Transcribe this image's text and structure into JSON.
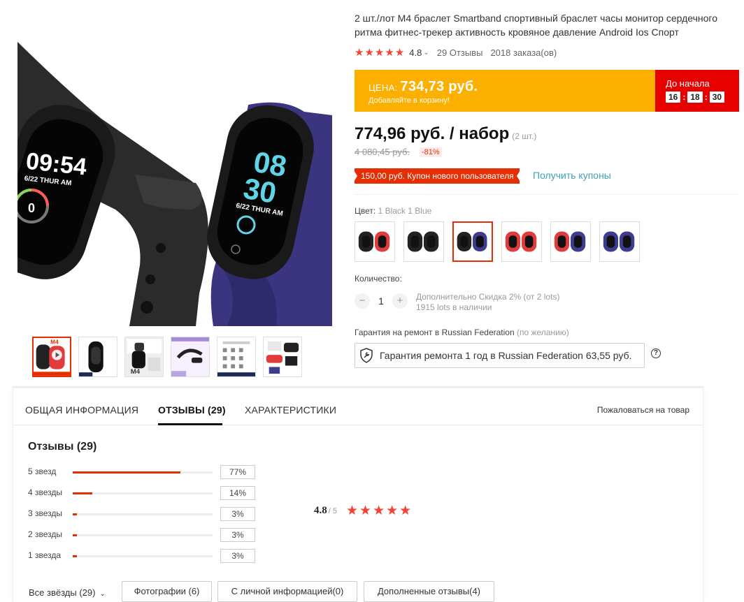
{
  "product": {
    "title": "2 шт./лот M4 браслет Smartband спортивный браслет часы монитор сердечного ритма фитнес-трекер активность кровяное давление Android Ios Спорт",
    "rating": "4.8",
    "reviews_count": "29 Отзывы",
    "orders": "2018 заказа(ов)"
  },
  "main_image": {
    "left_watch_time": "09:54",
    "left_watch_date": "6/22 THUR AM",
    "right_watch_hour": "08",
    "right_watch_min": "30",
    "right_watch_date": "6/22 THUR AM"
  },
  "thumbs": [
    {
      "name": "thumb-1",
      "label": "M4"
    },
    {
      "name": "thumb-2"
    },
    {
      "name": "thumb-3",
      "label": "M4"
    },
    {
      "name": "thumb-4"
    },
    {
      "name": "thumb-5"
    },
    {
      "name": "thumb-6"
    }
  ],
  "deal": {
    "price_label": "ЦЕНА:",
    "price_value": "734,73 руб.",
    "hint": "Добавляйте в корзину!",
    "timer_label": "До начала",
    "hours": "16",
    "minutes": "18",
    "seconds": "30"
  },
  "price": {
    "current": "774,96 руб. / набор",
    "units": "(2 шт.)",
    "old": "4 080,45 руб.",
    "discount": "-81%"
  },
  "coupon": {
    "text": "150,00 руб. Купон нового пользователя",
    "link": "Получить купоны"
  },
  "color": {
    "label": "Цвет:",
    "selected": "1 Black 1 Blue",
    "options": [
      {
        "a": "#222222",
        "b": "#e23b3b"
      },
      {
        "a": "#222222",
        "b": "#222222"
      },
      {
        "a": "#222222",
        "b": "#3d3c8f"
      },
      {
        "a": "#e23b3b",
        "b": "#e23b3b"
      },
      {
        "a": "#e23b3b",
        "b": "#3d3c8f"
      },
      {
        "a": "#3d3c8f",
        "b": "#3d3c8f"
      }
    ],
    "selected_index": 2
  },
  "quantity": {
    "label": "Количество:",
    "value": "1",
    "minus": "−",
    "plus": "+",
    "discount_note": "Дополнительно Скидка 2% (от 2 lots)",
    "stock": "1915 lots в наличии"
  },
  "warranty": {
    "label": "Гарантия на ремонт в Russian Federation",
    "optional": "(по желанию)",
    "option": "Гарантия ремонта 1 год в Russian Federation 63,55 руб.",
    "help": "?"
  },
  "tabs": {
    "items": [
      "ОБЩАЯ ИНФОРМАЦИЯ",
      "ОТЗЫВЫ (29)",
      "ХАРАКТЕРИСТИКИ"
    ],
    "active": 1,
    "report": "Пожаловаться на товар"
  },
  "reviews": {
    "title": "Отзывы (29)",
    "histogram": [
      {
        "label": "5 звезд",
        "percent": 77,
        "text": "77%"
      },
      {
        "label": "4 звезды",
        "percent": 14,
        "text": "14%"
      },
      {
        "label": "3 звезды",
        "percent": 3,
        "text": "3%"
      },
      {
        "label": "2 звезды",
        "percent": 3,
        "text": "3%"
      },
      {
        "label": "1 звезда",
        "percent": 3,
        "text": "3%"
      }
    ],
    "average": "4.8",
    "out_of": "/ 5",
    "filters": {
      "select": "Все звёзды (29)",
      "photos": "Фотографии (6)",
      "personal": "С личной информацией(0)",
      "additional": "Дополненные отзывы(4)"
    }
  },
  "colors": {
    "accent": "#e62e04",
    "deal_yellow": "#fbb000",
    "timer_red": "#e60000",
    "link": "#3f9fb6",
    "star": "#f44336"
  }
}
